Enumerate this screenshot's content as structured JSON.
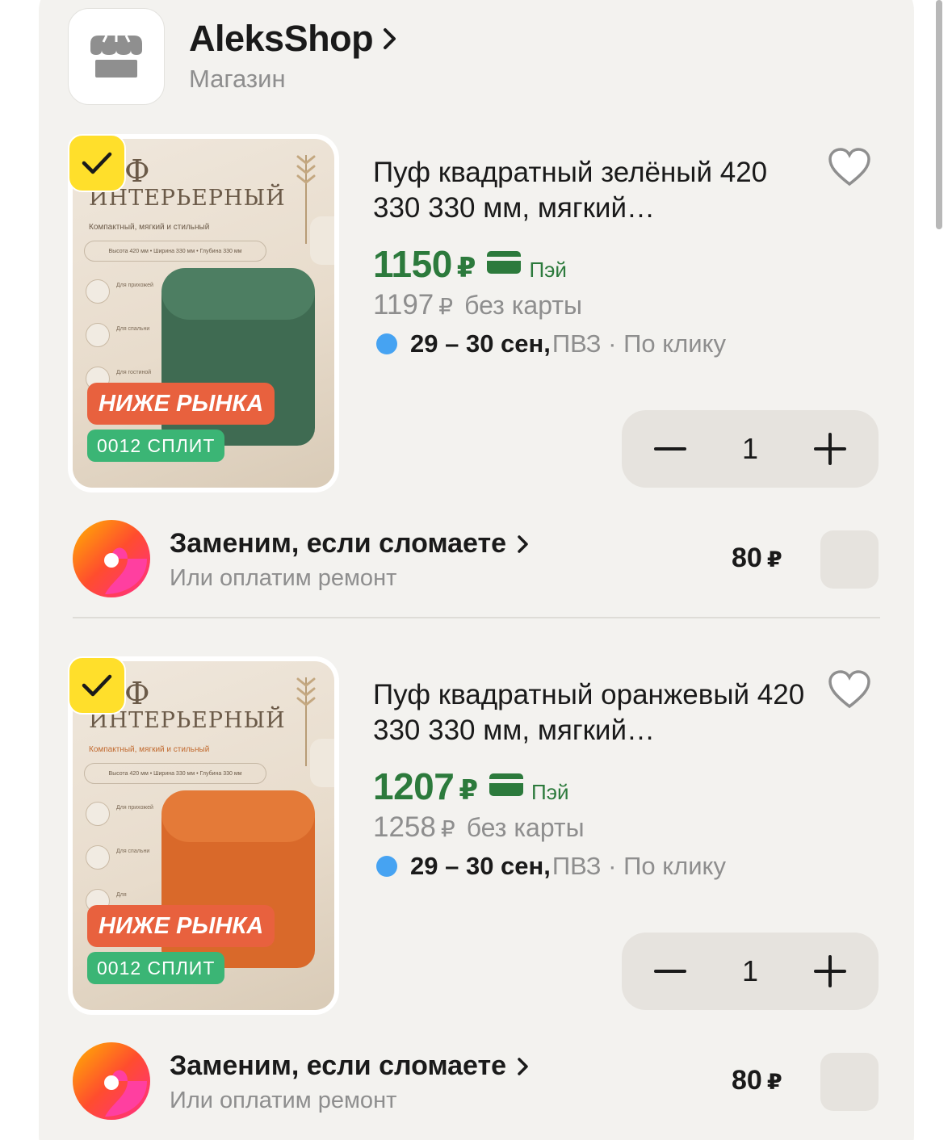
{
  "shop": {
    "name": "AleksShop",
    "subtitle": "Магазин"
  },
  "products": [
    {
      "image": {
        "title_1": "Ф",
        "title_2": "ИНТЕРЬЕРНЫЙ",
        "subtitle": "Компактный, мягкий и стильный",
        "dims": "Высота 420 мм  •  Ширина 330 мм  •  Глубина 330 мм",
        "features": [
          "Для прихожей",
          "Для спальни",
          "Для гостиной"
        ],
        "pouf_color": "#3f6b52",
        "accent_text_color": "#6b5a48"
      },
      "selected": true,
      "badge_market": "НИЖЕ РЫНКА",
      "badge_split": "0012 СПЛИТ",
      "title": "Пуф квадратный зелёный 420 330 330 мм, мягкий…",
      "price": "1150",
      "currency": "₽",
      "pay_label": "Пэй",
      "old_price": "1197",
      "old_note": "без карты",
      "delivery_date": "29 – 30 сен,",
      "delivery_rest": " ПВЗ · По клику",
      "quantity": "1",
      "insurance": {
        "title": "Заменим, если сломаете",
        "subtitle": "Или оплатим ремонт",
        "price": "80",
        "currency": "₽"
      }
    },
    {
      "image": {
        "title_1": "Ф",
        "title_2": "ИНТЕРЬЕРНЫЙ",
        "subtitle": "Компактный, мягкий и стильный",
        "dims": "Высота 420 мм  •  Ширина 330 мм  •  Глубина 330 мм",
        "features": [
          "Для прихожей",
          "Для спальни",
          "Для"
        ],
        "pouf_color": "#d9692a",
        "accent_text_color": "#c1692e"
      },
      "selected": true,
      "badge_market": "НИЖЕ РЫНКА",
      "badge_split": "0012 СПЛИТ",
      "title": "Пуф квадратный оранжевый 420 330 330 мм, мягкий…",
      "price": "1207",
      "currency": "₽",
      "pay_label": "Пэй",
      "old_price": "1258",
      "old_note": "без карты",
      "delivery_date": "29 – 30 сен,",
      "delivery_rest": " ПВЗ · По клику",
      "quantity": "1",
      "insurance": {
        "title": "Заменим, если сломаете",
        "subtitle": "Или оплатим ремонт",
        "price": "80",
        "currency": "₽"
      }
    }
  ],
  "colors": {
    "price_green": "#2c7a3c",
    "selected_yellow": "#ffdf2b",
    "badge_orange": "#e8613e",
    "badge_green": "#3bb575",
    "delivery_dot": "#46a3f2"
  },
  "icons": [
    "store-icon",
    "chevron-right-icon",
    "checkmark-icon",
    "heart-icon",
    "card-icon",
    "minus-icon",
    "plus-icon",
    "insurance-logo-icon"
  ]
}
